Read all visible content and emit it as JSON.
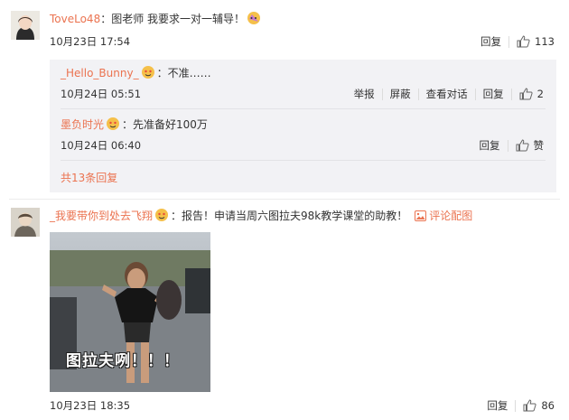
{
  "comment1": {
    "username": "ToveLo48",
    "text": "：图老师 我要求一对一辅导！",
    "time": "10月23日 17:54",
    "reply_label": "回复",
    "likes": "113"
  },
  "replies": [
    {
      "username": "_Hello_Bunny_",
      "text": "：不准……",
      "time": "10月24日 05:51",
      "actions": [
        "举报",
        "屏蔽",
        "查看对话",
        "回复"
      ],
      "likes": "2"
    },
    {
      "username": "墨负时光",
      "text": "：先准备好100万",
      "time": "10月24日 06:40",
      "actions": [
        "回复"
      ],
      "likes": "赞"
    }
  ],
  "expand_label": "共13条回复",
  "comment2": {
    "username": "_我要带你到处去飞翔",
    "text": "：报告！申请当周六图拉夫98k教学课堂的助教！",
    "pic_link": "评论配图",
    "photo_caption": "图拉夫咧！！！",
    "time": "10月23日 18:35",
    "reply_label": "回复",
    "likes": "86"
  },
  "colors": {
    "accent": "#eb7350",
    "reply_bg": "#f2f2f5"
  }
}
